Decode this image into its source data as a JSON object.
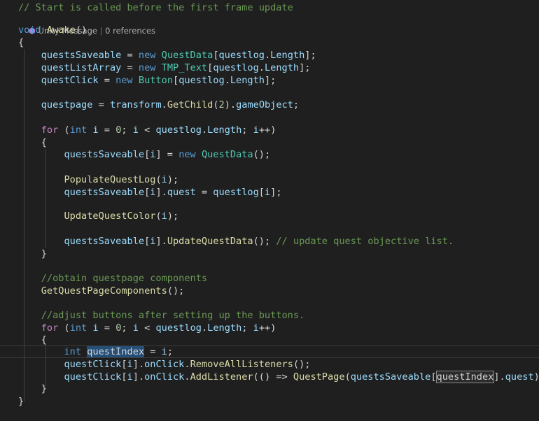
{
  "editor": {
    "theme_colors": {
      "background": "#1f1f1f",
      "keyword": "#569cd6",
      "control": "#c586c0",
      "type": "#4ec9b0",
      "function": "#dcdcaa",
      "variable": "#9cdcfe",
      "number": "#b5cea8",
      "comment": "#6a9955"
    },
    "codelens": {
      "icon": "unity-icon",
      "unity_message": "Unity Message",
      "separator": " | ",
      "references": "0 references"
    },
    "lines": [
      [
        [
          "cm",
          "// Start is called before the first frame update"
        ]
      ],
      [
        [
          "kw",
          "void"
        ],
        [
          "op",
          " "
        ],
        [
          "fn",
          "Awake"
        ],
        [
          "op",
          "()"
        ]
      ],
      [
        [
          "op",
          "{"
        ]
      ],
      [
        [
          "op",
          ""
        ]
      ],
      [
        [
          "op",
          "    "
        ],
        [
          "var",
          "questsSaveable"
        ],
        [
          "op",
          " = "
        ],
        [
          "kw",
          "new"
        ],
        [
          "op",
          " "
        ],
        [
          "type",
          "QuestData"
        ],
        [
          "op",
          "["
        ],
        [
          "var",
          "questlog"
        ],
        [
          "op",
          "."
        ],
        [
          "var",
          "Length"
        ],
        [
          "op",
          "];"
        ]
      ],
      [
        [
          "op",
          "    "
        ],
        [
          "var",
          "questListArray"
        ],
        [
          "op",
          " = "
        ],
        [
          "kw",
          "new"
        ],
        [
          "op",
          " "
        ],
        [
          "type",
          "TMP_Text"
        ],
        [
          "op",
          "["
        ],
        [
          "var",
          "questlog"
        ],
        [
          "op",
          "."
        ],
        [
          "var",
          "Length"
        ],
        [
          "op",
          "];"
        ]
      ],
      [
        [
          "op",
          "    "
        ],
        [
          "var",
          "questClick"
        ],
        [
          "op",
          " = "
        ],
        [
          "kw",
          "new"
        ],
        [
          "op",
          " "
        ],
        [
          "type",
          "Button"
        ],
        [
          "op",
          "["
        ],
        [
          "var",
          "questlog"
        ],
        [
          "op",
          "."
        ],
        [
          "var",
          "Length"
        ],
        [
          "op",
          "];"
        ]
      ],
      [
        [
          "op",
          ""
        ]
      ],
      [
        [
          "op",
          "    "
        ],
        [
          "var",
          "questpage"
        ],
        [
          "op",
          " = "
        ],
        [
          "var",
          "transform"
        ],
        [
          "op",
          "."
        ],
        [
          "fn",
          "GetChild"
        ],
        [
          "op",
          "("
        ],
        [
          "num",
          "2"
        ],
        [
          "op",
          ")."
        ],
        [
          "var",
          "gameObject"
        ],
        [
          "op",
          ";"
        ]
      ],
      [
        [
          "op",
          ""
        ]
      ],
      [
        [
          "op",
          "    "
        ],
        [
          "ctrl",
          "for"
        ],
        [
          "op",
          " ("
        ],
        [
          "kw",
          "int"
        ],
        [
          "op",
          " "
        ],
        [
          "var",
          "i"
        ],
        [
          "op",
          " = "
        ],
        [
          "num",
          "0"
        ],
        [
          "op",
          "; "
        ],
        [
          "var",
          "i"
        ],
        [
          "op",
          " < "
        ],
        [
          "var",
          "questlog"
        ],
        [
          "op",
          "."
        ],
        [
          "var",
          "Length"
        ],
        [
          "op",
          "; "
        ],
        [
          "var",
          "i"
        ],
        [
          "op",
          "++)"
        ]
      ],
      [
        [
          "op",
          "    {"
        ]
      ],
      [
        [
          "op",
          "        "
        ],
        [
          "var",
          "questsSaveable"
        ],
        [
          "op",
          "["
        ],
        [
          "var",
          "i"
        ],
        [
          "op",
          "] = "
        ],
        [
          "kw",
          "new"
        ],
        [
          "op",
          " "
        ],
        [
          "type",
          "QuestData"
        ],
        [
          "op",
          "();"
        ]
      ],
      [
        [
          "op",
          ""
        ]
      ],
      [
        [
          "op",
          "        "
        ],
        [
          "fn",
          "PopulateQuestLog"
        ],
        [
          "op",
          "("
        ],
        [
          "var",
          "i"
        ],
        [
          "op",
          ");"
        ]
      ],
      [
        [
          "op",
          "        "
        ],
        [
          "var",
          "questsSaveable"
        ],
        [
          "op",
          "["
        ],
        [
          "var",
          "i"
        ],
        [
          "op",
          "]."
        ],
        [
          "var",
          "quest"
        ],
        [
          "op",
          " = "
        ],
        [
          "var",
          "questlog"
        ],
        [
          "op",
          "["
        ],
        [
          "var",
          "i"
        ],
        [
          "op",
          "];"
        ]
      ],
      [
        [
          "op",
          ""
        ]
      ],
      [
        [
          "op",
          "        "
        ],
        [
          "fn",
          "UpdateQuestColor"
        ],
        [
          "op",
          "("
        ],
        [
          "var",
          "i"
        ],
        [
          "op",
          ");"
        ]
      ],
      [
        [
          "op",
          ""
        ]
      ],
      [
        [
          "op",
          "        "
        ],
        [
          "var",
          "questsSaveable"
        ],
        [
          "op",
          "["
        ],
        [
          "var",
          "i"
        ],
        [
          "op",
          "]."
        ],
        [
          "fn",
          "UpdateQuestData"
        ],
        [
          "op",
          "(); "
        ],
        [
          "cm",
          "// update quest objective list."
        ]
      ],
      [
        [
          "op",
          "    }"
        ]
      ],
      [
        [
          "op",
          ""
        ]
      ],
      [
        [
          "op",
          "    "
        ],
        [
          "cm",
          "//obtain questpage components"
        ]
      ],
      [
        [
          "op",
          "    "
        ],
        [
          "fn",
          "GetQuestPageComponents"
        ],
        [
          "op",
          "();"
        ]
      ],
      [
        [
          "op",
          ""
        ]
      ],
      [
        [
          "op",
          "    "
        ],
        [
          "cm",
          "//adjust buttons after setting up the buttons."
        ]
      ],
      [
        [
          "op",
          "    "
        ],
        [
          "ctrl",
          "for"
        ],
        [
          "op",
          " ("
        ],
        [
          "kw",
          "int"
        ],
        [
          "op",
          " "
        ],
        [
          "var",
          "i"
        ],
        [
          "op",
          " = "
        ],
        [
          "num",
          "0"
        ],
        [
          "op",
          "; "
        ],
        [
          "var",
          "i"
        ],
        [
          "op",
          " < "
        ],
        [
          "var",
          "questlog"
        ],
        [
          "op",
          "."
        ],
        [
          "var",
          "Length"
        ],
        [
          "op",
          "; "
        ],
        [
          "var",
          "i"
        ],
        [
          "op",
          "++)"
        ]
      ],
      [
        [
          "op",
          "    {"
        ]
      ],
      [
        [
          "op",
          "        "
        ],
        [
          "kw",
          "int"
        ],
        [
          "op",
          " "
        ],
        [
          "hl",
          "questIndex"
        ],
        [
          "op",
          " = "
        ],
        [
          "var",
          "i"
        ],
        [
          "op",
          ";"
        ]
      ],
      [
        [
          "op",
          "        "
        ],
        [
          "var",
          "questClick"
        ],
        [
          "op",
          "["
        ],
        [
          "var",
          "i"
        ],
        [
          "op",
          "]."
        ],
        [
          "var",
          "onClick"
        ],
        [
          "op",
          "."
        ],
        [
          "fn",
          "RemoveAllListeners"
        ],
        [
          "op",
          "();"
        ]
      ],
      [
        [
          "op",
          "        "
        ],
        [
          "var",
          "questClick"
        ],
        [
          "op",
          "["
        ],
        [
          "var",
          "i"
        ],
        [
          "op",
          "]."
        ],
        [
          "var",
          "onClick"
        ],
        [
          "op",
          "."
        ],
        [
          "fn",
          "AddListener"
        ],
        [
          "op",
          "(() => "
        ],
        [
          "fn",
          "QuestPage"
        ],
        [
          "op",
          "("
        ],
        [
          "var",
          "questsSaveable"
        ],
        [
          "op",
          "["
        ],
        [
          "hl2",
          "questIndex"
        ],
        [
          "op",
          "]."
        ],
        [
          "var",
          "quest"
        ],
        [
          "op",
          "));"
        ]
      ],
      [
        [
          "op",
          "    }"
        ]
      ],
      [
        [
          "op",
          "}"
        ]
      ]
    ]
  }
}
